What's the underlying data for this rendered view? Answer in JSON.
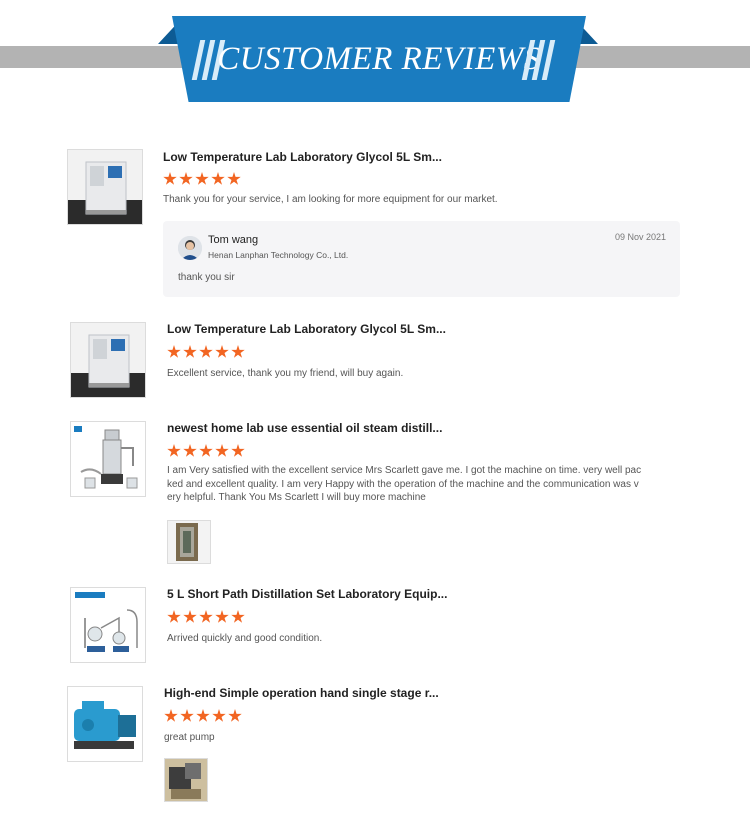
{
  "banner": {
    "title": "CUSTOMER REVIEWS"
  },
  "colors": {
    "banner_blue": "#1a7cc0",
    "banner_dark": "#0d5b94",
    "band_gray": "#b3b3b3",
    "star_orange": "#f26522"
  },
  "reviews": [
    {
      "title": "Low Temperature Lab Laboratory Glycol 5L Sm...",
      "rating": 5,
      "text": "Thank you for your service, I am looking for more equipment for our market.",
      "thumbnail": "chiller-unit-image",
      "reply": {
        "name": "Tom wang",
        "company": "Henan Lanphan Technology Co., Ltd.",
        "date": "09 Nov 2021",
        "text": "thank you sir"
      }
    },
    {
      "title": "Low Temperature Lab Laboratory Glycol 5L Sm...",
      "rating": 5,
      "text": "Excellent service,  thank you my friend, will buy again.",
      "thumbnail": "chiller-unit-image"
    },
    {
      "title": "newest home lab use essential oil steam distill...",
      "rating": 5,
      "text_lines": [
        "I am Very satisfied with the excellent service Mrs Scarlett gave me. I got the machine on time. very well pac",
        "ked and excellent quality. I am very Happy with the operation of the machine and the communication was v",
        "ery helpful. Thank You Ms Scarlett I will buy more machine"
      ],
      "thumbnail": "steam-distiller-image",
      "photo": "customer-photo"
    },
    {
      "title": "5 L Short Path Distillation Set Laboratory Equip...",
      "rating": 5,
      "text": "Arrived quickly and good condition.",
      "thumbnail": "short-path-distillation-image"
    },
    {
      "title": "High-end Simple operation hand single stage r...",
      "rating": 5,
      "text": "great pump",
      "thumbnail": "vacuum-pump-image",
      "photo": "customer-photo"
    }
  ]
}
